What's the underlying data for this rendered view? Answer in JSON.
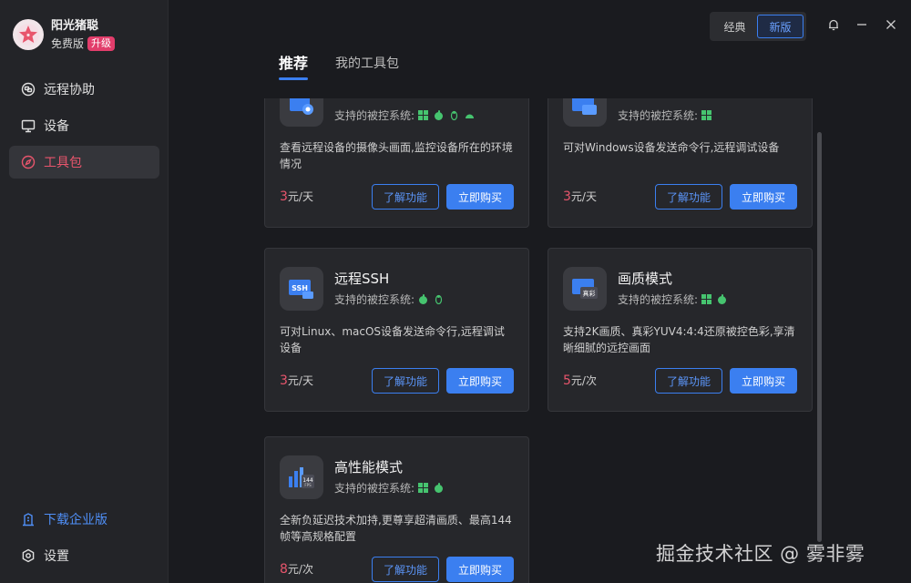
{
  "app": {
    "username": "阳光猪聪",
    "plan": "免费版",
    "upgrade_label": "升级"
  },
  "sidebar": {
    "items": [
      {
        "label": "远程协助",
        "icon": "remote-assist-icon"
      },
      {
        "label": "设备",
        "icon": "monitor-icon"
      },
      {
        "label": "工具包",
        "icon": "compass-icon",
        "active": true
      }
    ],
    "bottom": [
      {
        "label": "下载企业版",
        "icon": "building-icon"
      },
      {
        "label": "设置",
        "icon": "gear-icon"
      }
    ]
  },
  "header": {
    "tabs": [
      {
        "label": "推荐",
        "active": true
      },
      {
        "label": "我的工具包"
      }
    ],
    "version_switch": {
      "classic": "经典",
      "new": "新版",
      "selected": "新版"
    }
  },
  "cards": [
    {
      "title": "",
      "os_label": "支持的被控系统:",
      "os": [
        "windows",
        "apple",
        "linux",
        "android"
      ],
      "desc": "查看远程设备的摄像头画面,监控设备所在的环境情况",
      "price_num": "3",
      "price_unit": "元/天",
      "learn": "了解功能",
      "buy": "立即购买",
      "icon": "camera-icon"
    },
    {
      "title": "",
      "os_label": "支持的被控系统:",
      "os": [
        "windows"
      ],
      "desc": "可对Windows设备发送命令行,远程调试设备",
      "price_num": "3",
      "price_unit": "元/天",
      "learn": "了解功能",
      "buy": "立即购买",
      "icon": "cmd-icon"
    },
    {
      "title": "远程SSH",
      "os_label": "支持的被控系统:",
      "os": [
        "apple",
        "linux"
      ],
      "desc": "可对Linux、macOS设备发送命令行,远程调试设备",
      "price_num": "3",
      "price_unit": "元/天",
      "learn": "了解功能",
      "buy": "立即购买",
      "icon": "ssh-icon",
      "icon_text": "SSH"
    },
    {
      "title": "画质模式",
      "os_label": "支持的被控系统:",
      "os": [
        "windows",
        "apple"
      ],
      "desc": "支持2K画质、真彩YUV4:4:4还原被控色彩,享清晰细腻的远控画面",
      "price_num": "5",
      "price_unit": "元/次",
      "learn": "了解功能",
      "buy": "立即购买",
      "icon": "true-color-icon",
      "icon_text": "真彩"
    },
    {
      "title": "高性能模式",
      "os_label": "支持的被控系统:",
      "os": [
        "windows",
        "apple"
      ],
      "desc": "全新负延迟技术加持,更尊享超清画质、最高144帧等高规格配置",
      "price_num": "8",
      "price_unit": "元/次",
      "learn": "了解功能",
      "buy": "立即购买",
      "icon": "fps-icon",
      "icon_text": "144",
      "icon_subtext": "FPS"
    }
  ],
  "watermark": "掘金技术社区 @ 雾非雾",
  "colors": {
    "accent": "#3b7ff0",
    "brand": "#e8556c",
    "background": "#1a1b1f",
    "sidebar": "#232428",
    "card": "#26272b"
  }
}
